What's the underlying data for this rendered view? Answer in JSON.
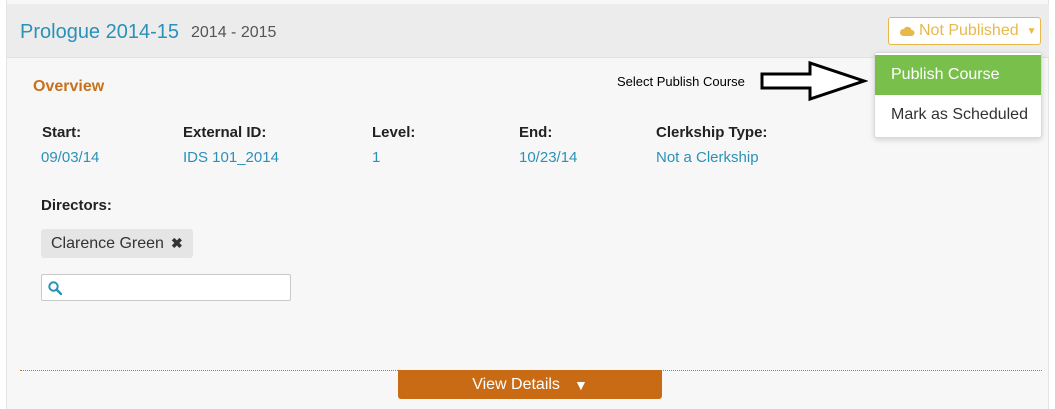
{
  "course": {
    "title": "Prologue 2014-15",
    "years": "2014 - 2015",
    "status_label": "Not Published",
    "status_color": "#e8b94a"
  },
  "publish_menu": {
    "items": [
      {
        "label": "Publish Course",
        "highlighted": true,
        "color": "#78c04b"
      },
      {
        "label": "Mark as Scheduled",
        "highlighted": false
      }
    ]
  },
  "annotation": {
    "text": "Select Publish Course"
  },
  "overview": {
    "heading": "Overview",
    "fields": [
      {
        "label": "Start:",
        "value": "09/03/14"
      },
      {
        "label": "External ID:",
        "value": "IDS 101_2014"
      },
      {
        "label": "Level:",
        "value": "1"
      },
      {
        "label": "End:",
        "value": "10/23/14"
      },
      {
        "label": "Clerkship Type:",
        "value": "Not a Clerkship"
      }
    ],
    "directors_label": "Directors:",
    "directors": [
      "Clarence Green"
    ],
    "director_search_placeholder": ""
  },
  "footer": {
    "view_details_label": "View Details",
    "view_details_color": "#c96b14"
  },
  "icons": {
    "status": "cloud-icon",
    "status_caret": "caret-down-icon",
    "remove_director": "close-icon",
    "search": "search-icon",
    "view_details": "triangle-down-icon"
  }
}
